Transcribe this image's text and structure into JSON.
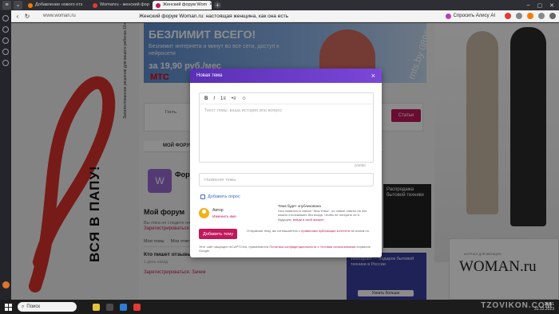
{
  "browser": {
    "tabs": [
      {
        "label": "Добавление нового отз",
        "favicon_color": "#f57c00",
        "active": false
      },
      {
        "label": "Womanru - женский фор",
        "favicon_color": "#e53935",
        "active": false
      },
      {
        "label": "Женский форум Wom",
        "favicon_color": "#c2185b",
        "active": true
      }
    ],
    "url_domain": "www.woman.ru",
    "page_title": "Женский форум Woman.ru: настоящая женщина, как она есть",
    "ask_alice": "Спросить Алису AI"
  },
  "page": {
    "banner": {
      "headline": "БЕЗЛИМИТ ВСЕГО!",
      "text": "Безлимит интернета и минут во все сети, доступ к нейросети",
      "price": "за 19,90 руб./мес",
      "brand": "МТС",
      "url": "mts.by 0890"
    },
    "vertical_text": "ВСЯ В ПАПУ!",
    "vertical_small": "Запатентованное решение для вашего ребенка 18+",
    "topcard_user": "Гость",
    "stati_button": "Статьи",
    "forum_bar_label": "МОЙ ФОРУМ",
    "forum_logo": "W",
    "forum_title": "Форум",
    "my_forum_heading": "Мой форум",
    "my_forum_text": "Вы пока не следите ни за одной темой",
    "my_forum_link": "Зарегистрироваться",
    "tabs": [
      "Мои темы",
      "Мои ответы"
    ],
    "question": "Кто пишет отзывы на сайтах отзовиках?",
    "question_meta": "1 день назад",
    "reply_label": "+ Ответ",
    "register_prompt": "Зарегистрироваться. Зачем",
    "ad_right_text": "Распродажа бытовой техники",
    "promo_text": "Webogram — подарок бытовой техники в России",
    "promo_button": "Узнать больше",
    "woman_small": "ЖУРНАЛ ДЛЯ ЖЕНЩИН",
    "woman_logo": "WOMAN.ru"
  },
  "modal": {
    "title": "Новая тема",
    "toolbar": {
      "bold": "B",
      "italic": "I",
      "ordered_list": "1≡",
      "bullet_list": "•≡",
      "emoji": "☺"
    },
    "editor_placeholder": "Текст темы: ваша история или вопрос",
    "char_counter": "0/4000",
    "title_placeholder": "Название темы",
    "add_poll": "Добавить опрос",
    "author_label": "Автор",
    "author_change": "Изменить имя",
    "anon_title": "Тема будет опубликована",
    "anon_text": "Она появится в списке \"Мои темы\", но новые ответы на нее можно отслеживать без входа. Чтобы не потерять ее в будущем,",
    "anon_link": "войди в свой аккаунт",
    "submit": "Добавить тему",
    "rules_prefix": "Отправляя тему, вы соглашаетесь с",
    "rules_link": "правилами публикации контента",
    "rules_suffix": "на woman.ru",
    "recaptcha_prefix": "Этот сайт защищен reCAPTCHA, применяются",
    "recaptcha_privacy": "Политика конфиденциальности",
    "recaptcha_and": "и",
    "recaptcha_terms": "Условия использования",
    "recaptcha_suffix": "сервисов Google."
  },
  "taskbar": {
    "search": "Поиск",
    "time": "14:51",
    "date": "31.12.2023"
  },
  "watermark": "TZOVIKON.COM",
  "colors": {
    "accent": "#c2185b",
    "modal_header": "#6a3bc8",
    "link": "#3a6cc5"
  }
}
